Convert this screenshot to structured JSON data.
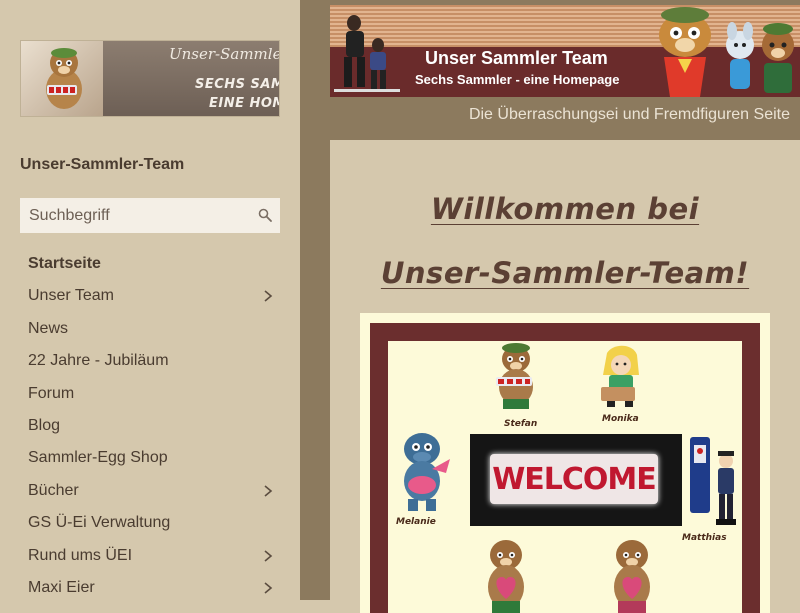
{
  "sidebar": {
    "logo": {
      "script_text": "Unser-Sammler-Team",
      "line1": "SECHS SAMMLER -",
      "line2": "EINE HOMEPAGE"
    },
    "site_title": "Unser-Sammler-Team",
    "search": {
      "placeholder": "Suchbegriff"
    },
    "nav": [
      {
        "label": "Startseite",
        "active": true,
        "has_children": false
      },
      {
        "label": "Unser Team",
        "has_children": true
      },
      {
        "label": "News",
        "has_children": false
      },
      {
        "label": "22 Jahre - Jubiläum",
        "has_children": false
      },
      {
        "label": "Forum",
        "has_children": false
      },
      {
        "label": "Blog",
        "has_children": false
      },
      {
        "label": "Sammler-Egg Shop",
        "has_children": false
      },
      {
        "label": "Bücher",
        "has_children": true
      },
      {
        "label": "GS Ü-Ei Verwaltung",
        "has_children": false
      },
      {
        "label": "Rund ums ÜEI",
        "has_children": true
      },
      {
        "label": "Maxi Eier",
        "has_children": true
      }
    ]
  },
  "header": {
    "banner_title": "Unser Sammler Team",
    "banner_subtitle": "Sechs Sammler - eine Homepage",
    "tagline": "Die Überraschungsei und Fremdfiguren Seite"
  },
  "main": {
    "welcome_line1": "Willkommen bei",
    "welcome_line2": "Unser-Sammler-Team!",
    "image": {
      "sign_text": "WELCOME",
      "names": [
        "Stefan",
        "Monika",
        "Melanie",
        "Matthias"
      ]
    }
  },
  "colors": {
    "background": "#d5c8ad",
    "header_band": "#8c7a5e",
    "banner_red": "#6a2b2b",
    "frame_red": "#6b2e2e",
    "text": "#4a3c30"
  }
}
